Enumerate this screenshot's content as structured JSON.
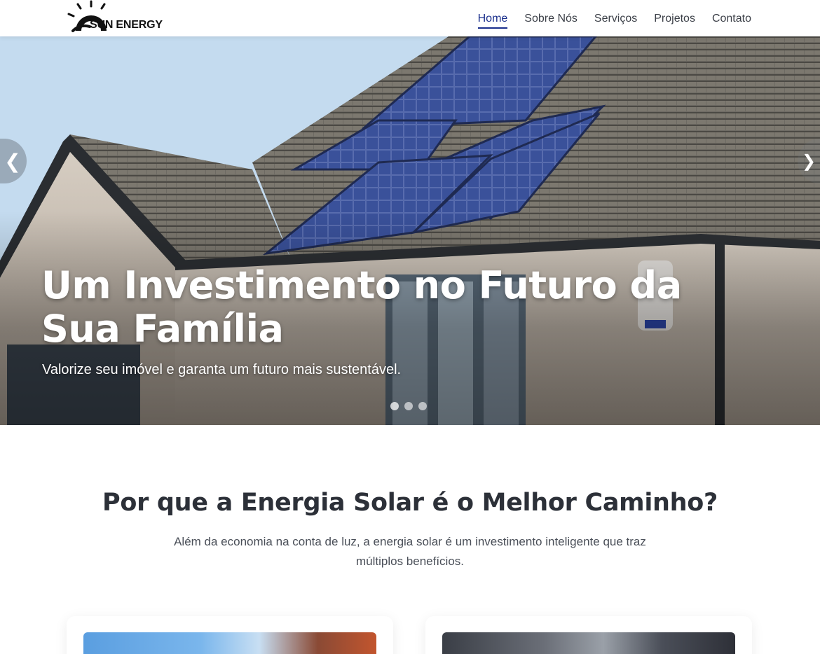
{
  "header": {
    "logo_text": "SUN ENERGY",
    "nav": [
      {
        "label": "Home",
        "active": true
      },
      {
        "label": "Sobre Nós",
        "active": false
      },
      {
        "label": "Serviços",
        "active": false
      },
      {
        "label": "Projetos",
        "active": false
      },
      {
        "label": "Contato",
        "active": false
      }
    ],
    "accent_color": "#1a2f8c"
  },
  "hero": {
    "title": "Um Investimento no Futuro da Sua Família",
    "subtitle": "Valorize seu imóvel e garanta um futuro mais sustentável.",
    "prev_icon": "chevron-left-icon",
    "next_icon": "chevron-right-icon",
    "prev_glyph": "❮",
    "next_glyph": "❯",
    "slides_count": 3,
    "active_slide": 1
  },
  "benefits": {
    "title": "Por que a Energia Solar é o Melhor Caminho?",
    "description": "Além da economia na conta de luz, a energia solar é um investimento inteligente que traz múltiplos benefícios."
  }
}
